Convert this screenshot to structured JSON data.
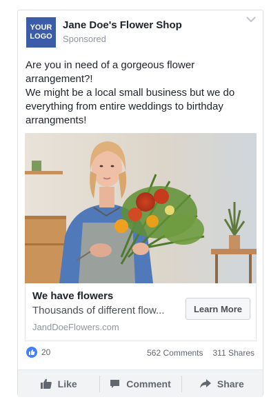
{
  "ad": {
    "logo_line1": "YOUR",
    "logo_line2": "LOGO",
    "page_name": "Jane Doe's Flower Shop",
    "sponsored": "Sponsored",
    "text_lines": [
      "Are you in need of a gorgeous flower",
      "arrangement?!",
      "We might be a local small business but we do",
      "everything from entire weddings to birthday",
      "arrangments!"
    ]
  },
  "link": {
    "title": "We have flowers",
    "description": "Thousands of different flow...",
    "url": "JandDoeFlowers.com",
    "cta": "Learn More"
  },
  "engagement": {
    "reactions": "20",
    "comments": "562 Comments",
    "shares": "311 Shares"
  },
  "actions": {
    "like": "Like",
    "comment": "Comment",
    "share": "Share"
  },
  "colors": {
    "logo_bg": "#3b5ca8",
    "like_blue": "#4080ff"
  },
  "icons": [
    "chevron-down-icon",
    "like-reaction-icon",
    "thumbs-up-icon",
    "comment-icon",
    "share-icon"
  ]
}
